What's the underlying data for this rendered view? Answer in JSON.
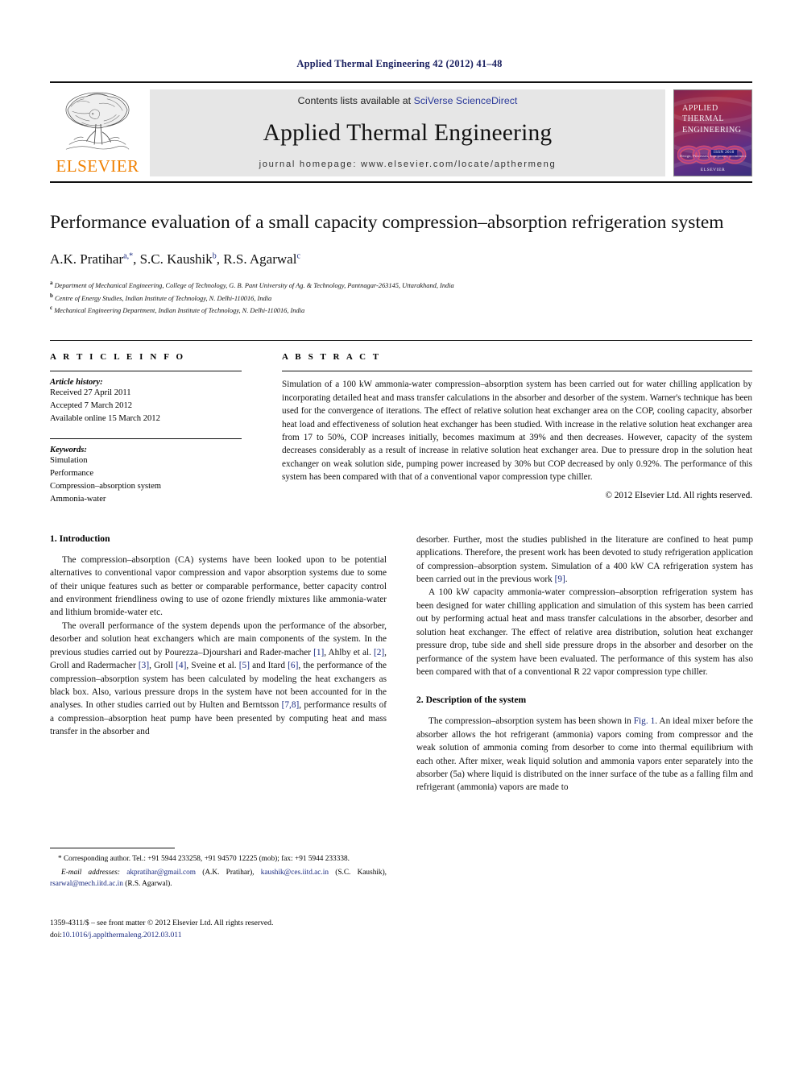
{
  "running_head": "Applied Thermal Engineering 42 (2012) 41–48",
  "masthead": {
    "contents_prefix": "Contents lists available at ",
    "sciencedirect": "SciVerse ScienceDirect",
    "journal_name": "Applied Thermal Engineering",
    "homepage": "journal homepage: www.elsevier.com/locate/apthermeng",
    "publisher": "ELSEVIER",
    "cover": {
      "line1": "APPLIED",
      "line2": "THERMAL",
      "line3": "ENGINEERING",
      "subtitle": "Design, Processes, Equipment, Economics",
      "badge": "ISSN 2010",
      "brand": "ELSEVIER"
    }
  },
  "article": {
    "title": "Performance evaluation of a small capacity compression–absorption refrigeration system",
    "authors": "A.K. Pratihar, S.C. Kaushik, R.S. Agarwal",
    "author_list": [
      {
        "name": "A.K. Pratihar",
        "marks": "a,*"
      },
      {
        "name": "S.C. Kaushik",
        "marks": "b"
      },
      {
        "name": "R.S. Agarwal",
        "marks": "c"
      }
    ],
    "affiliations": [
      {
        "mark": "a",
        "text": "Department of Mechanical Engineering, College of Technology, G. B. Pant University of Ag. & Technology, Pantnagar-263145, Uttarakhand, India"
      },
      {
        "mark": "b",
        "text": "Centre of Energy Studies, Indian Institute of Technology, N. Delhi-110016, India"
      },
      {
        "mark": "c",
        "text": "Mechanical Engineering Department, Indian Institute of Technology, N. Delhi-110016, India"
      }
    ]
  },
  "article_info": {
    "label": "A R T I C L E    I N F O",
    "history_head": "Article history:",
    "received": "Received 27 April 2011",
    "accepted": "Accepted 7 March 2012",
    "online": "Available online 15 March 2012",
    "keywords_head": "Keywords:",
    "keywords": [
      "Simulation",
      "Performance",
      "Compression–absorption system",
      "Ammonia-water"
    ]
  },
  "abstract": {
    "label": "A B S T R A C T",
    "text": "Simulation of a 100 kW ammonia-water compression–absorption system has been carried out for water chilling application by incorporating detailed heat and mass transfer calculations in the absorber and desorber of the system. Warner's technique has been used for the convergence of iterations. The effect of relative solution heat exchanger area on the COP, cooling capacity, absorber heat load and effectiveness of solution heat exchanger has been studied. With increase in the relative solution heat exchanger area from 17 to 50%, COP increases initially, becomes maximum at 39% and then decreases. However, capacity of the system decreases considerably as a result of increase in relative solution heat exchanger area. Due to pressure drop in the solution heat exchanger on weak solution side, pumping power increased by 30% but COP decreased by only 0.92%. The performance of this system has been compared with that of a conventional vapor compression type chiller.",
    "copyright": "© 2012 Elsevier Ltd. All rights reserved."
  },
  "sections": {
    "intro_heading": "1.  Introduction",
    "intro_p1": "The compression–absorption (CA) systems have been looked upon to be potential alternatives to conventional vapor compression and vapor absorption systems due to some of their unique features such as better or comparable performance, better capacity control and environment friendliness owing to use of ozone friendly mixtures like ammonia-water and lithium bromide-water etc.",
    "intro_p2_a": "The overall performance of the system depends upon the performance of the absorber, desorber and solution heat exchangers which are main components of the system. In the previous studies carried out by Pourezza–Djourshari and Rader-macher ",
    "cit1": "[1]",
    "intro_p2_b": ", Ahlby et al. ",
    "cit2": "[2]",
    "intro_p2_c": ", Groll and Radermacher ",
    "cit3": "[3]",
    "intro_p2_d": ", Groll ",
    "cit4": "[4]",
    "intro_p2_e": ", Sveine et al. ",
    "cit5": "[5]",
    "intro_p2_f": " and Itard ",
    "cit6": "[6]",
    "intro_p2_g": ", the performance of the compression–absorption system has been calculated by modeling the heat exchangers as black box. Also, various pressure drops in the system have not been accounted for in the analyses. In other studies carried out by Hulten and Berntsson ",
    "cit78": "[7,8]",
    "intro_p2_h": ", performance results of a compression–absorption heat pump have been presented by computing heat and mass transfer in the absorber and",
    "right_p1_a": "desorber. Further, most the studies published in the literature are confined to heat pump applications. Therefore, the present work has been devoted to study refrigeration application of compression–absorption system. Simulation of a 400 kW CA refrigeration system has been carried out in the previous work ",
    "cit9": "[9]",
    "right_p1_b": ".",
    "right_p2": "A 100 kW capacity ammonia-water compression–absorption refrigeration system has been designed for water chilling application and simulation of this system has been carried out by performing actual heat and mass transfer calculations in the absorber, desorber and solution heat exchanger. The effect of relative area distribution, solution heat exchanger pressure drop, tube side and shell side pressure drops in the absorber and desorber on the performance of the system have been evaluated. The performance of this system has also been compared with that of a conventional R 22 vapor compression type chiller.",
    "desc_heading": "2.  Description of the system",
    "desc_p1_a": "The compression–absorption system has been shown in ",
    "fig_ref": "Fig. 1",
    "desc_p1_b": ". An ideal mixer before the absorber allows the hot refrigerant (ammonia) vapors coming from compressor and the weak solution of ammonia coming from desorber to come into thermal equilibrium with each other. After mixer, weak liquid solution and ammonia vapors enter separately into the absorber (5a) where liquid is distributed on the inner surface of the tube as a falling film and refrigerant (ammonia) vapors are made to"
  },
  "footnotes": {
    "corresponding": "* Corresponding author. Tel.: +91 5944 233258, +91 94570 12225 (mob); fax: +91 5944 233338.",
    "email_label": "E-mail addresses:",
    "email1": "akpratihar@gmail.com",
    "email1_owner": " (A.K. Pratihar), ",
    "email2": "kaushik@ces.iitd.ac.in",
    "email2_owner": " (S.C. Kaushik), ",
    "email3": "rsarwal@mech.iitd.ac.in",
    "email3_owner": " (R.S. Agarwal)."
  },
  "imprint": {
    "line1": "1359-4311/$ – see front matter © 2012 Elsevier Ltd. All rights reserved.",
    "doi_label": "doi:",
    "doi": "10.1016/j.applthermaleng.2012.03.011"
  },
  "colors": {
    "link": "#1a2a80",
    "elsevier_orange": "#F08000",
    "band_gray": "#e6e6e6"
  }
}
